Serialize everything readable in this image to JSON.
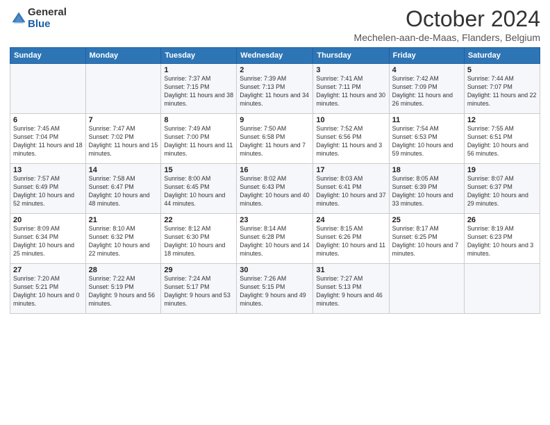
{
  "header": {
    "logo_general": "General",
    "logo_blue": "Blue",
    "month_title": "October 2024",
    "location": "Mechelen-aan-de-Maas, Flanders, Belgium"
  },
  "days_of_week": [
    "Sunday",
    "Monday",
    "Tuesday",
    "Wednesday",
    "Thursday",
    "Friday",
    "Saturday"
  ],
  "weeks": [
    [
      {
        "day": "",
        "info": ""
      },
      {
        "day": "",
        "info": ""
      },
      {
        "day": "1",
        "info": "Sunrise: 7:37 AM\nSunset: 7:15 PM\nDaylight: 11 hours and 38 minutes."
      },
      {
        "day": "2",
        "info": "Sunrise: 7:39 AM\nSunset: 7:13 PM\nDaylight: 11 hours and 34 minutes."
      },
      {
        "day": "3",
        "info": "Sunrise: 7:41 AM\nSunset: 7:11 PM\nDaylight: 11 hours and 30 minutes."
      },
      {
        "day": "4",
        "info": "Sunrise: 7:42 AM\nSunset: 7:09 PM\nDaylight: 11 hours and 26 minutes."
      },
      {
        "day": "5",
        "info": "Sunrise: 7:44 AM\nSunset: 7:07 PM\nDaylight: 11 hours and 22 minutes."
      }
    ],
    [
      {
        "day": "6",
        "info": "Sunrise: 7:45 AM\nSunset: 7:04 PM\nDaylight: 11 hours and 18 minutes."
      },
      {
        "day": "7",
        "info": "Sunrise: 7:47 AM\nSunset: 7:02 PM\nDaylight: 11 hours and 15 minutes."
      },
      {
        "day": "8",
        "info": "Sunrise: 7:49 AM\nSunset: 7:00 PM\nDaylight: 11 hours and 11 minutes."
      },
      {
        "day": "9",
        "info": "Sunrise: 7:50 AM\nSunset: 6:58 PM\nDaylight: 11 hours and 7 minutes."
      },
      {
        "day": "10",
        "info": "Sunrise: 7:52 AM\nSunset: 6:56 PM\nDaylight: 11 hours and 3 minutes."
      },
      {
        "day": "11",
        "info": "Sunrise: 7:54 AM\nSunset: 6:53 PM\nDaylight: 10 hours and 59 minutes."
      },
      {
        "day": "12",
        "info": "Sunrise: 7:55 AM\nSunset: 6:51 PM\nDaylight: 10 hours and 56 minutes."
      }
    ],
    [
      {
        "day": "13",
        "info": "Sunrise: 7:57 AM\nSunset: 6:49 PM\nDaylight: 10 hours and 52 minutes."
      },
      {
        "day": "14",
        "info": "Sunrise: 7:58 AM\nSunset: 6:47 PM\nDaylight: 10 hours and 48 minutes."
      },
      {
        "day": "15",
        "info": "Sunrise: 8:00 AM\nSunset: 6:45 PM\nDaylight: 10 hours and 44 minutes."
      },
      {
        "day": "16",
        "info": "Sunrise: 8:02 AM\nSunset: 6:43 PM\nDaylight: 10 hours and 40 minutes."
      },
      {
        "day": "17",
        "info": "Sunrise: 8:03 AM\nSunset: 6:41 PM\nDaylight: 10 hours and 37 minutes."
      },
      {
        "day": "18",
        "info": "Sunrise: 8:05 AM\nSunset: 6:39 PM\nDaylight: 10 hours and 33 minutes."
      },
      {
        "day": "19",
        "info": "Sunrise: 8:07 AM\nSunset: 6:37 PM\nDaylight: 10 hours and 29 minutes."
      }
    ],
    [
      {
        "day": "20",
        "info": "Sunrise: 8:09 AM\nSunset: 6:34 PM\nDaylight: 10 hours and 25 minutes."
      },
      {
        "day": "21",
        "info": "Sunrise: 8:10 AM\nSunset: 6:32 PM\nDaylight: 10 hours and 22 minutes."
      },
      {
        "day": "22",
        "info": "Sunrise: 8:12 AM\nSunset: 6:30 PM\nDaylight: 10 hours and 18 minutes."
      },
      {
        "day": "23",
        "info": "Sunrise: 8:14 AM\nSunset: 6:28 PM\nDaylight: 10 hours and 14 minutes."
      },
      {
        "day": "24",
        "info": "Sunrise: 8:15 AM\nSunset: 6:26 PM\nDaylight: 10 hours and 11 minutes."
      },
      {
        "day": "25",
        "info": "Sunrise: 8:17 AM\nSunset: 6:25 PM\nDaylight: 10 hours and 7 minutes."
      },
      {
        "day": "26",
        "info": "Sunrise: 8:19 AM\nSunset: 6:23 PM\nDaylight: 10 hours and 3 minutes."
      }
    ],
    [
      {
        "day": "27",
        "info": "Sunrise: 7:20 AM\nSunset: 5:21 PM\nDaylight: 10 hours and 0 minutes."
      },
      {
        "day": "28",
        "info": "Sunrise: 7:22 AM\nSunset: 5:19 PM\nDaylight: 9 hours and 56 minutes."
      },
      {
        "day": "29",
        "info": "Sunrise: 7:24 AM\nSunset: 5:17 PM\nDaylight: 9 hours and 53 minutes."
      },
      {
        "day": "30",
        "info": "Sunrise: 7:26 AM\nSunset: 5:15 PM\nDaylight: 9 hours and 49 minutes."
      },
      {
        "day": "31",
        "info": "Sunrise: 7:27 AM\nSunset: 5:13 PM\nDaylight: 9 hours and 46 minutes."
      },
      {
        "day": "",
        "info": ""
      },
      {
        "day": "",
        "info": ""
      }
    ]
  ]
}
